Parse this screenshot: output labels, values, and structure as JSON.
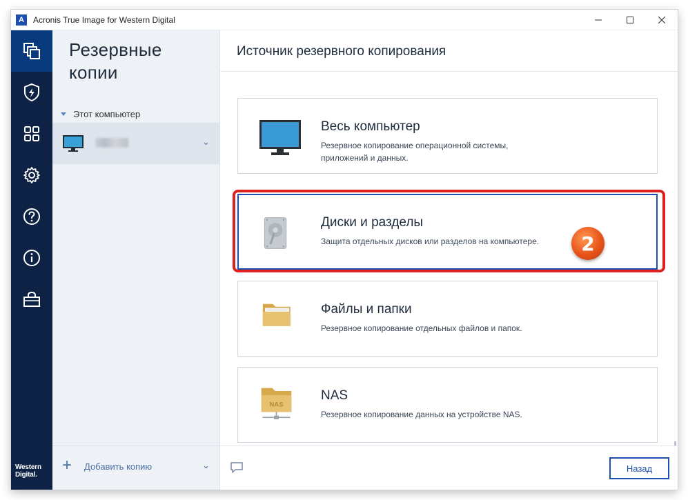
{
  "window": {
    "title": "Acronis True Image for Western Digital",
    "logo_letter": "A",
    "controls": [
      "minimize-icon",
      "maximize-icon",
      "close-icon"
    ]
  },
  "rail": {
    "items": [
      {
        "icon": "backup-icon",
        "active": true
      },
      {
        "icon": "protection-icon",
        "active": false
      },
      {
        "icon": "tools-icon",
        "active": false
      },
      {
        "icon": "gear-icon",
        "active": false
      },
      {
        "icon": "help-icon",
        "active": false
      },
      {
        "icon": "info-icon",
        "active": false
      },
      {
        "icon": "store-icon",
        "active": false
      }
    ],
    "brand": "Western Digital."
  },
  "backups_panel": {
    "title_line1": "Резервные",
    "title_line2": "копии",
    "group_label": "Этот компьютер",
    "add_label": "Добавить копию"
  },
  "main": {
    "title": "Источник резервного копирования",
    "cards": [
      {
        "title": "Весь компьютер",
        "desc": "Резервное копирование операционной системы, приложений и данных.",
        "icon": "monitor-icon",
        "selected": false
      },
      {
        "title": "Диски и разделы",
        "desc": "Защита отдельных дисков или разделов на компьютере.",
        "icon": "hard-drive-icon",
        "selected": true
      },
      {
        "title": "Файлы и папки",
        "desc": "Резервное копирование отдельных файлов и папок.",
        "icon": "folder-icon",
        "selected": false
      },
      {
        "title": "NAS",
        "desc": "Резервное копирование данных на устройстве NAS.",
        "icon": "nas-folder-icon",
        "selected": false
      }
    ],
    "step_badge": "2",
    "nas_folder_label": "NAS",
    "back_label": "Назад"
  },
  "colors": {
    "rail_bg": "#0d2245",
    "rail_active": "#0a3a7e",
    "accent": "#1d4fb3",
    "highlight": "#e02020",
    "badge": "#e8531a"
  }
}
